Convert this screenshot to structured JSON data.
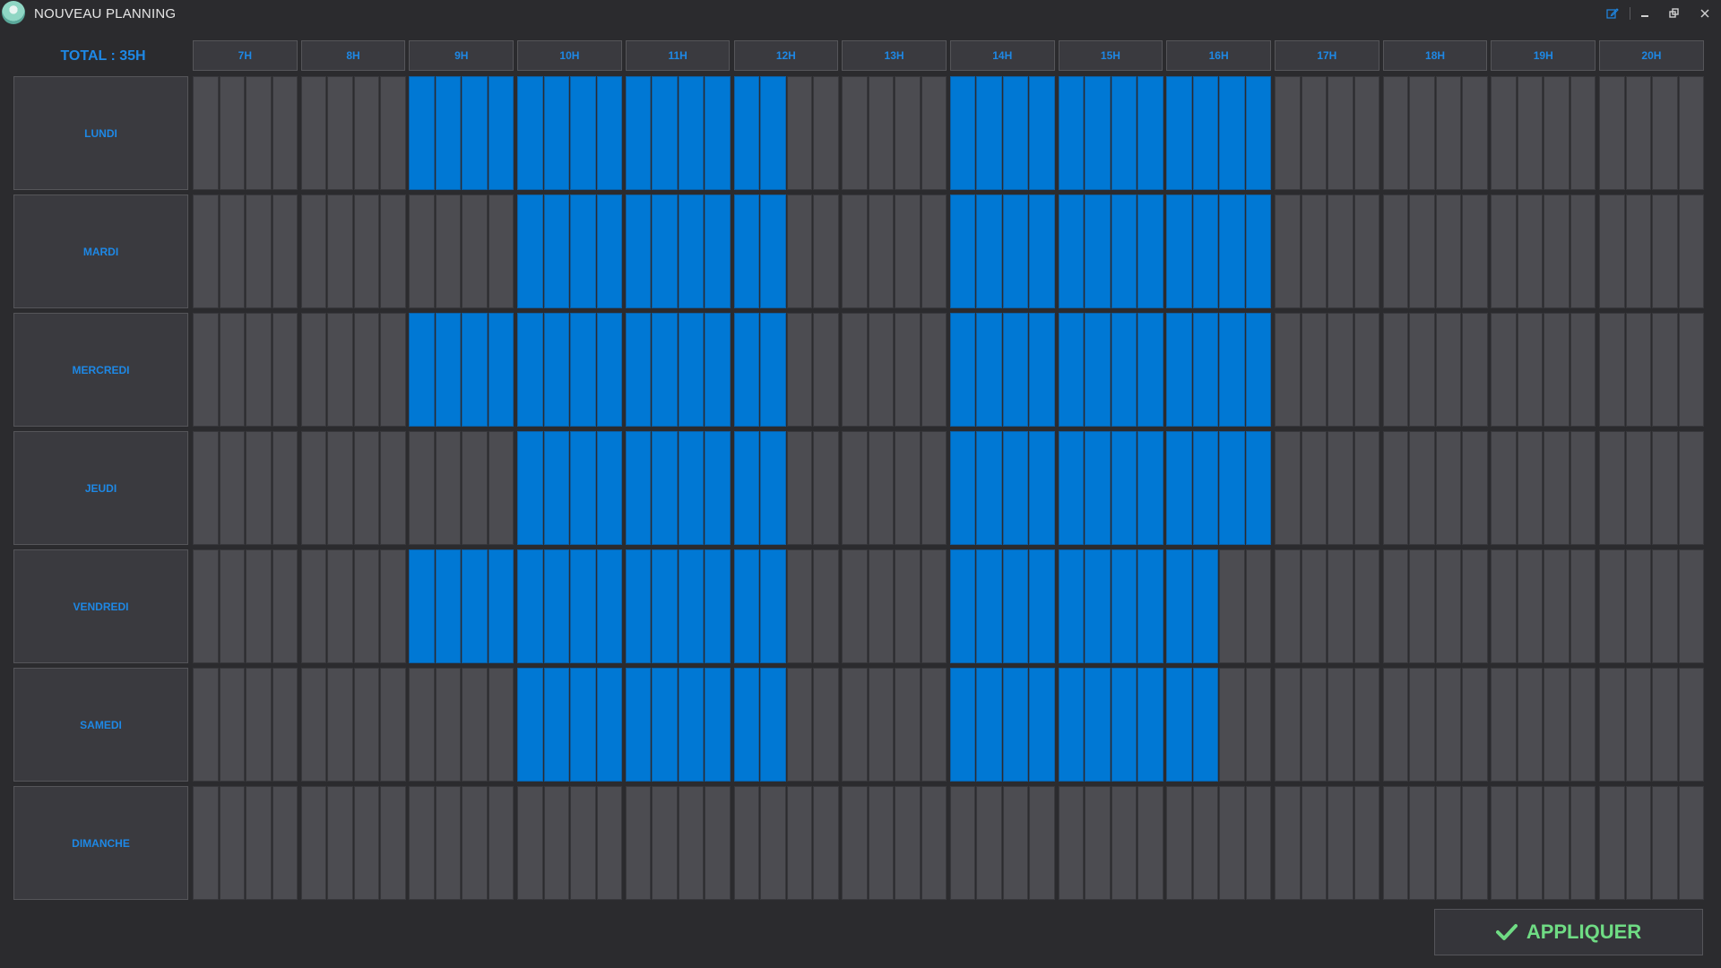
{
  "window": {
    "title": "NOUVEAU PLANNING"
  },
  "colors": {
    "accent": "#1e88e5",
    "active_slot": "#0078d4",
    "inactive_slot": "#4c4c51",
    "apply_text": "#6fdc84",
    "background": "#2b2b2e"
  },
  "total": "TOTAL : 35H",
  "hours": [
    "7H",
    "8H",
    "9H",
    "10H",
    "11H",
    "12H",
    "13H",
    "14H",
    "15H",
    "16H",
    "17H",
    "18H",
    "19H",
    "20H"
  ],
  "slots_per_hour": 4,
  "days": [
    {
      "label": "LUNDI",
      "active": [
        [
          9,
          0
        ],
        [
          9,
          1
        ],
        [
          9,
          2
        ],
        [
          9,
          3
        ],
        [
          10,
          0
        ],
        [
          10,
          1
        ],
        [
          10,
          2
        ],
        [
          10,
          3
        ],
        [
          11,
          0
        ],
        [
          11,
          1
        ],
        [
          11,
          2
        ],
        [
          11,
          3
        ],
        [
          12,
          0
        ],
        [
          12,
          1
        ],
        [
          14,
          0
        ],
        [
          14,
          1
        ],
        [
          14,
          2
        ],
        [
          14,
          3
        ],
        [
          15,
          0
        ],
        [
          15,
          1
        ],
        [
          15,
          2
        ],
        [
          15,
          3
        ],
        [
          16,
          0
        ],
        [
          16,
          1
        ],
        [
          16,
          2
        ],
        [
          16,
          3
        ]
      ]
    },
    {
      "label": "MARDI",
      "active": [
        [
          10,
          0
        ],
        [
          10,
          1
        ],
        [
          10,
          2
        ],
        [
          10,
          3
        ],
        [
          11,
          0
        ],
        [
          11,
          1
        ],
        [
          11,
          2
        ],
        [
          11,
          3
        ],
        [
          12,
          0
        ],
        [
          12,
          1
        ],
        [
          14,
          0
        ],
        [
          14,
          1
        ],
        [
          14,
          2
        ],
        [
          14,
          3
        ],
        [
          15,
          0
        ],
        [
          15,
          1
        ],
        [
          15,
          2
        ],
        [
          15,
          3
        ],
        [
          16,
          0
        ],
        [
          16,
          1
        ],
        [
          16,
          2
        ],
        [
          16,
          3
        ]
      ]
    },
    {
      "label": "MERCREDI",
      "active": [
        [
          9,
          0
        ],
        [
          9,
          1
        ],
        [
          9,
          2
        ],
        [
          9,
          3
        ],
        [
          10,
          0
        ],
        [
          10,
          1
        ],
        [
          10,
          2
        ],
        [
          10,
          3
        ],
        [
          11,
          0
        ],
        [
          11,
          1
        ],
        [
          11,
          2
        ],
        [
          11,
          3
        ],
        [
          12,
          0
        ],
        [
          12,
          1
        ],
        [
          14,
          0
        ],
        [
          14,
          1
        ],
        [
          14,
          2
        ],
        [
          14,
          3
        ],
        [
          15,
          0
        ],
        [
          15,
          1
        ],
        [
          15,
          2
        ],
        [
          15,
          3
        ],
        [
          16,
          0
        ],
        [
          16,
          1
        ],
        [
          16,
          2
        ],
        [
          16,
          3
        ]
      ]
    },
    {
      "label": "JEUDI",
      "active": [
        [
          10,
          0
        ],
        [
          10,
          1
        ],
        [
          10,
          2
        ],
        [
          10,
          3
        ],
        [
          11,
          0
        ],
        [
          11,
          1
        ],
        [
          11,
          2
        ],
        [
          11,
          3
        ],
        [
          12,
          0
        ],
        [
          12,
          1
        ],
        [
          14,
          0
        ],
        [
          14,
          1
        ],
        [
          14,
          2
        ],
        [
          14,
          3
        ],
        [
          15,
          0
        ],
        [
          15,
          1
        ],
        [
          15,
          2
        ],
        [
          15,
          3
        ],
        [
          16,
          0
        ],
        [
          16,
          1
        ],
        [
          16,
          2
        ],
        [
          16,
          3
        ]
      ]
    },
    {
      "label": "VENDREDI",
      "active": [
        [
          9,
          0
        ],
        [
          9,
          1
        ],
        [
          9,
          2
        ],
        [
          9,
          3
        ],
        [
          10,
          0
        ],
        [
          10,
          1
        ],
        [
          10,
          2
        ],
        [
          10,
          3
        ],
        [
          11,
          0
        ],
        [
          11,
          1
        ],
        [
          11,
          2
        ],
        [
          11,
          3
        ],
        [
          12,
          0
        ],
        [
          12,
          1
        ],
        [
          14,
          0
        ],
        [
          14,
          1
        ],
        [
          14,
          2
        ],
        [
          14,
          3
        ],
        [
          15,
          0
        ],
        [
          15,
          1
        ],
        [
          15,
          2
        ],
        [
          15,
          3
        ],
        [
          16,
          0
        ],
        [
          16,
          1
        ]
      ]
    },
    {
      "label": "SAMEDI",
      "active": [
        [
          10,
          0
        ],
        [
          10,
          1
        ],
        [
          10,
          2
        ],
        [
          10,
          3
        ],
        [
          11,
          0
        ],
        [
          11,
          1
        ],
        [
          11,
          2
        ],
        [
          11,
          3
        ],
        [
          12,
          0
        ],
        [
          12,
          1
        ],
        [
          14,
          0
        ],
        [
          14,
          1
        ],
        [
          14,
          2
        ],
        [
          14,
          3
        ],
        [
          15,
          0
        ],
        [
          15,
          1
        ],
        [
          15,
          2
        ],
        [
          15,
          3
        ],
        [
          16,
          0
        ],
        [
          16,
          1
        ]
      ]
    },
    {
      "label": "DIMANCHE",
      "active": []
    }
  ],
  "apply_button": {
    "label": "APPLIQUER",
    "icon": "checkmark-icon"
  },
  "window_controls": [
    "edit-icon",
    "minimize-icon",
    "restore-icon",
    "close-icon"
  ]
}
